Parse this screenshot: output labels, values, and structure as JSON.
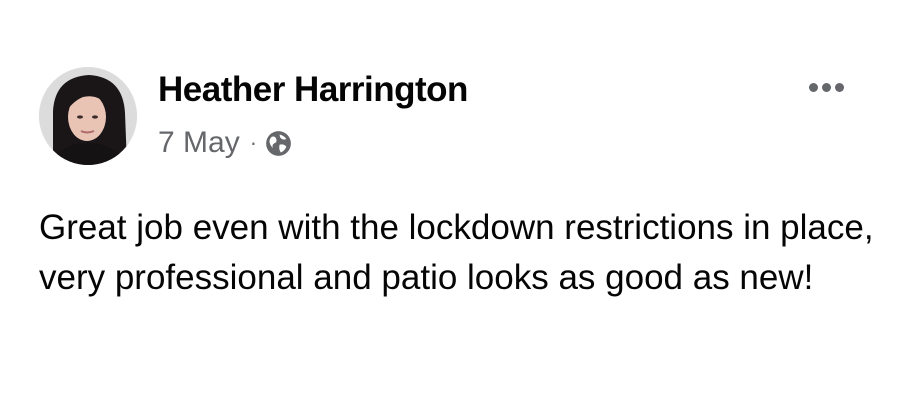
{
  "post": {
    "author": "Heather Harrington",
    "date": "7 May",
    "separator": "·",
    "audience_icon": "globe-icon",
    "more_icon": "more-options-icon",
    "body": "Great job even with the lockdown restrictions in place, very professional and patio looks as good as new!"
  },
  "colors": {
    "primary_text": "#050505",
    "secondary_text": "#65676b",
    "background": "#ffffff"
  }
}
